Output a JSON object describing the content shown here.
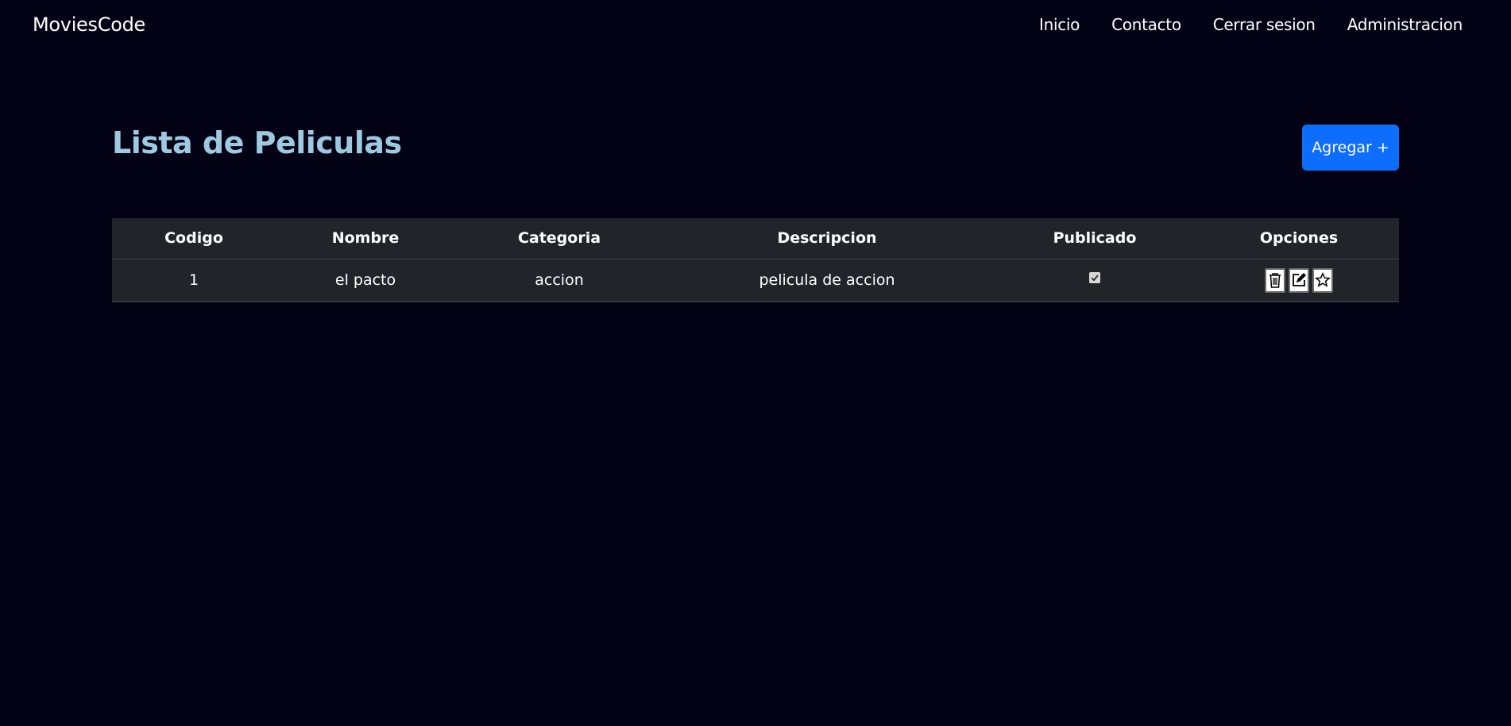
{
  "nav": {
    "brand": "MoviesCode",
    "links": [
      "Inicio",
      "Contacto",
      "Cerrar sesion",
      "Administracion"
    ]
  },
  "page": {
    "title": "Lista de Peliculas",
    "add_button": "Agregar +"
  },
  "table": {
    "headers": [
      "Codigo",
      "Nombre",
      "Categoria",
      "Descripcion",
      "Publicado",
      "Opciones"
    ],
    "rows": [
      {
        "codigo": "1",
        "nombre": "el pacto",
        "categoria": "accion",
        "descripcion": "pelicula de accion",
        "publicado": true,
        "options": [
          "trash-icon",
          "edit-icon",
          "star-icon"
        ]
      }
    ]
  },
  "colors": {
    "background": "#020214",
    "title": "#9ecae1",
    "accent": "#0d6efd",
    "table_bg": "#212529"
  }
}
